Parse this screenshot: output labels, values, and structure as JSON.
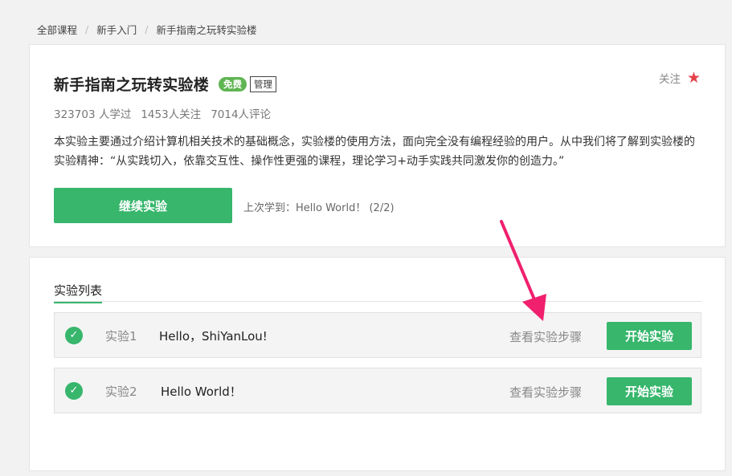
{
  "breadcrumb": {
    "items": [
      "全部课程",
      "新手入门",
      "新手指南之玩转实验楼"
    ],
    "separator": "/"
  },
  "course": {
    "title": "新手指南之玩转实验楼",
    "badge_free": "免费",
    "badge_manage": "管理",
    "follow_label": "关注",
    "stats": {
      "learned": "323703 人学过",
      "followers": "1453人关注",
      "comments": "7014人评论"
    },
    "description": "本实验主要通过介绍计算机相关技术的基础概念，实验楼的使用方法，面向完全没有编程经验的用户。从中我们将了解到实验楼的实验精神：“从实践切入，依靠交互性、操作性更强的课程，理论学习+动手实践共同激发你的创造力。”",
    "continue_label": "继续实验",
    "last_learn": "上次学到：Hello World！ (2/2)"
  },
  "experiments": {
    "section_title": "实验列表",
    "items": [
      {
        "no": "实验1",
        "name": "Hello，ShiYanLou!",
        "view_label": "查看实验步骤",
        "start_label": "开始实验",
        "done": true
      },
      {
        "no": "实验2",
        "name": "Hello World！",
        "view_label": "查看实验步骤",
        "start_label": "开始实验",
        "done": true
      }
    ]
  },
  "colors": {
    "accent_green": "#37b66c",
    "free_badge": "#60b553",
    "star_red": "#e5414b",
    "arrow_pink": "#f0206e"
  },
  "icons": {
    "star": "star-icon",
    "check": "check-circle-icon",
    "arrow": "annotation-arrow-icon"
  }
}
